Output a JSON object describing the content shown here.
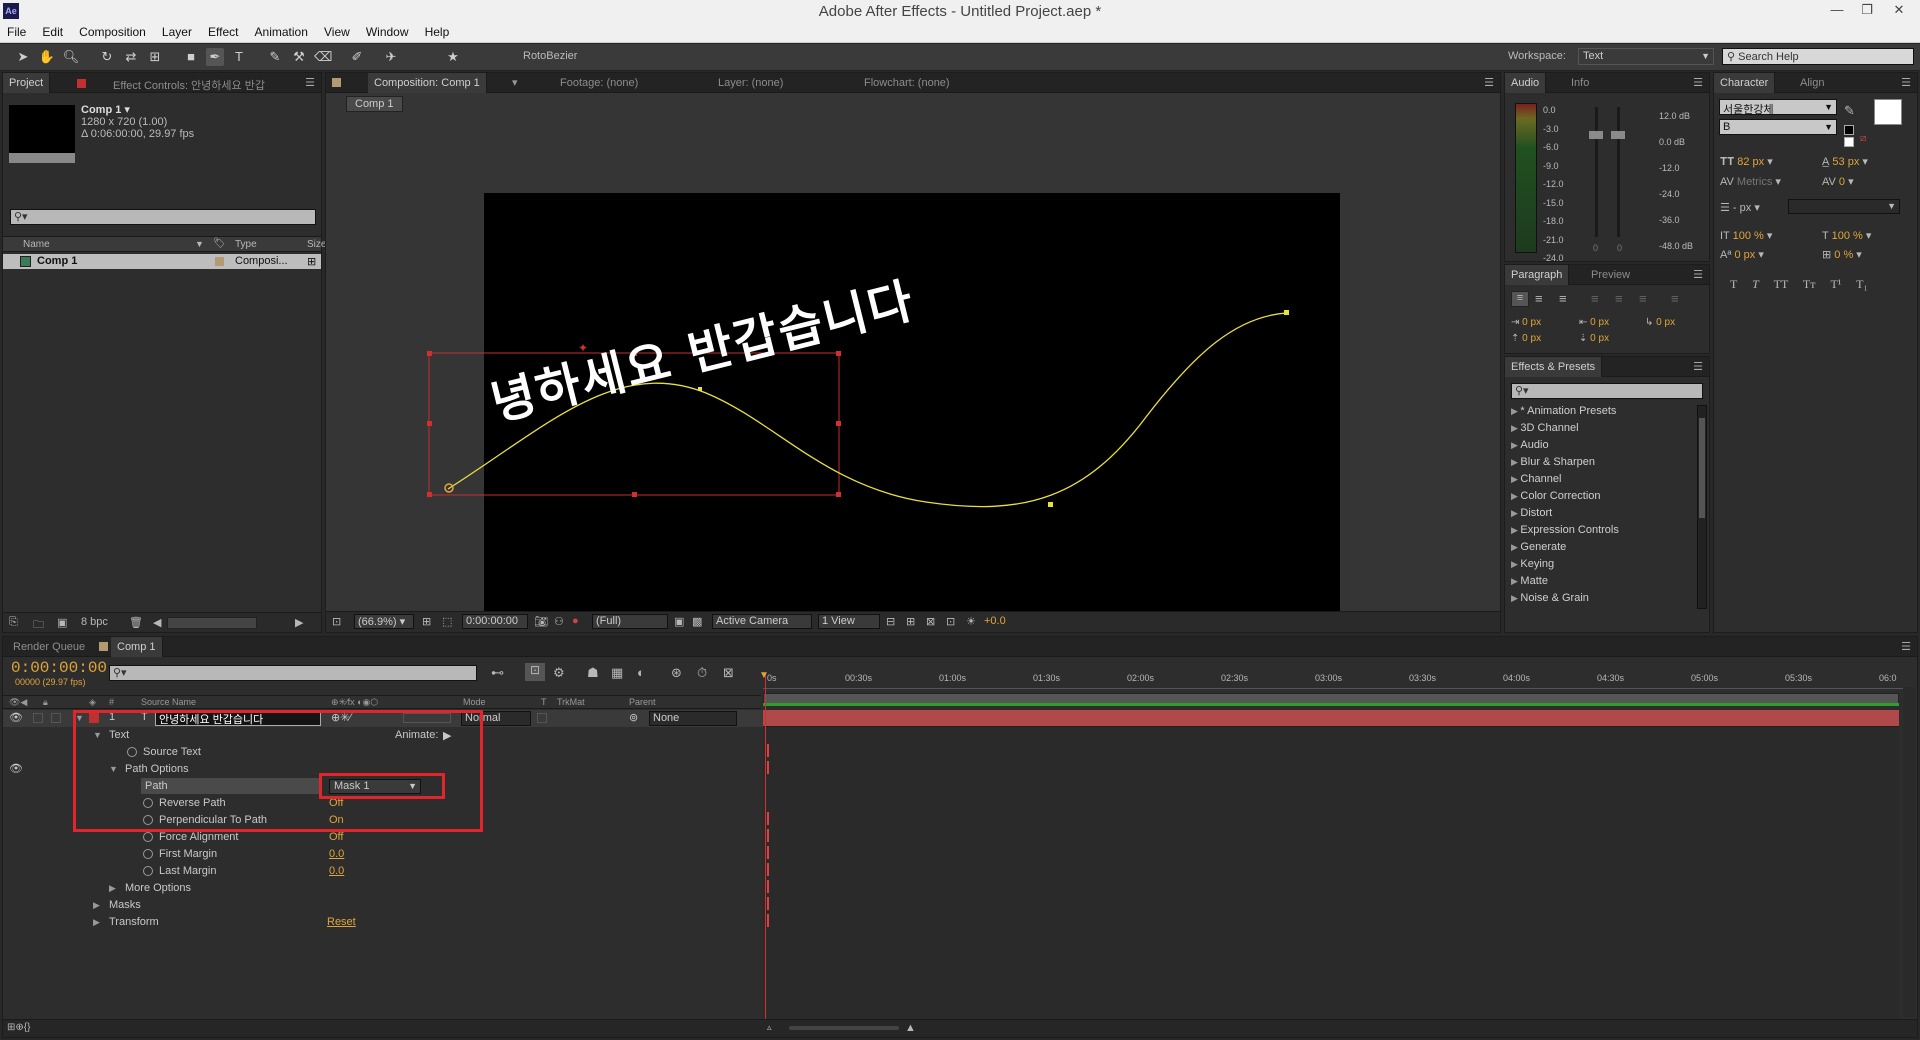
{
  "window": {
    "title": "Adobe After Effects - Untitled Project.aep *",
    "app_icon": "Ae"
  },
  "menu": [
    "File",
    "Edit",
    "Composition",
    "Layer",
    "Effect",
    "Animation",
    "View",
    "Window",
    "Help"
  ],
  "toolbar": {
    "rotobezier_label": "RotoBezier",
    "workspace_label": "Workspace:",
    "workspace_value": "Text",
    "search_help": "Search Help"
  },
  "project_panel": {
    "tab_project": "Project",
    "tab_effect_controls": "Effect Controls: 안녕하세요 반갑",
    "comp_name": "Comp 1 ▾",
    "comp_size": "1280 x 720 (1.00)",
    "comp_duration": "Δ 0:06:00:00, 29.97 fps",
    "col_name": "Name",
    "col_type": "Type",
    "col_size": "Size",
    "item_name": "Comp 1",
    "item_type": "Composi...",
    "bpc": "8 bpc"
  },
  "comp_viewer": {
    "tab_composition": "Composition: Comp 1",
    "tab_footage": "Footage: (none)",
    "tab_layer": "Layer: (none)",
    "tab_flowchart": "Flowchart: (none)",
    "breadcrumb": "Comp 1",
    "canvas_text": "녕하세요 반갑습니다",
    "zoom": "(66.9%)",
    "timecode": "0:00:00:00",
    "resolution": "(Full)",
    "camera": "Active Camera",
    "views": "1 View",
    "exposure": "+0.0"
  },
  "audio_panel": {
    "tab_audio": "Audio",
    "tab_info": "Info",
    "levels_left": [
      "0.0",
      "-3.0",
      "-6.0",
      "-9.0",
      "-12.0",
      "-15.0",
      "-18.0",
      "-21.0",
      "-24.0"
    ],
    "levels_right": [
      "12.0 dB",
      "0.0 dB",
      "-12.0",
      "-24.0",
      "-36.0",
      "-48.0 dB"
    ],
    "slider_zero_a": "0",
    "slider_zero_b": "0"
  },
  "paragraph_panel": {
    "tab_paragraph": "Paragraph",
    "tab_preview": "Preview",
    "indent_left": "0 px",
    "indent_right": "0 px",
    "indent_first": "0 px",
    "space_before": "0 px",
    "space_after": "0 px"
  },
  "effects_panel": {
    "tab": "Effects & Presets",
    "items": [
      "* Animation Presets",
      "3D Channel",
      "Audio",
      "Blur & Sharpen",
      "Channel",
      "Color Correction",
      "Distort",
      "Expression Controls",
      "Generate",
      "Keying",
      "Matte",
      "Noise & Grain"
    ]
  },
  "character_panel": {
    "tab_character": "Character",
    "tab_align": "Align",
    "font_family": "서울한강체",
    "font_style": "B",
    "font_size": "82 px",
    "leading": "53 px",
    "kerning": "Metrics",
    "tracking": "0",
    "stroke_width": "- px",
    "vert_scale": "100 %",
    "horiz_scale": "100 %",
    "baseline_shift": "0 px",
    "tsume": "0 %",
    "styles": [
      "T",
      "T",
      "TT",
      "Tт",
      "T¹",
      "T₁"
    ]
  },
  "timeline": {
    "tab_render": "Render Queue",
    "tab_comp": "Comp 1",
    "timecode": "0:00:00:00",
    "frame_info": "00000 (29.97 fps)",
    "col_num": "#",
    "col_source": "Source Name",
    "col_mode": "Mode",
    "col_t": "T",
    "col_trkmat": "TrkMat",
    "col_parent": "Parent",
    "layer_num": "1",
    "layer_name": "안녕하세요 반갑습니다",
    "layer_mode": "Normal",
    "layer_parent": "None",
    "animate_label": "Animate:",
    "props": {
      "text": "Text",
      "source_text": "Source Text",
      "path_options": "Path Options",
      "path": "Path",
      "path_value": "Mask 1",
      "reverse_path": "Reverse Path",
      "reverse_path_value": "Off",
      "perpendicular": "Perpendicular To Path",
      "perpendicular_value": "On",
      "force_alignment": "Force Alignment",
      "force_alignment_value": "Off",
      "first_margin": "First Margin",
      "first_margin_value": "0.0",
      "last_margin": "Last Margin",
      "last_margin_value": "0.0",
      "more_options": "More Options",
      "masks": "Masks",
      "transform": "Transform",
      "transform_value": "Reset"
    },
    "ruler": [
      "0s",
      "00:30s",
      "01:00s",
      "01:30s",
      "02:00s",
      "02:30s",
      "03:00s",
      "03:30s",
      "04:00s",
      "04:30s",
      "05:00s",
      "05:30s",
      "06:0"
    ]
  },
  "colors": {
    "accent": "#e0a53a",
    "highlight_box": "#e0262b",
    "path_curve": "#e8e040",
    "layer_bar": "#b04a4a"
  }
}
